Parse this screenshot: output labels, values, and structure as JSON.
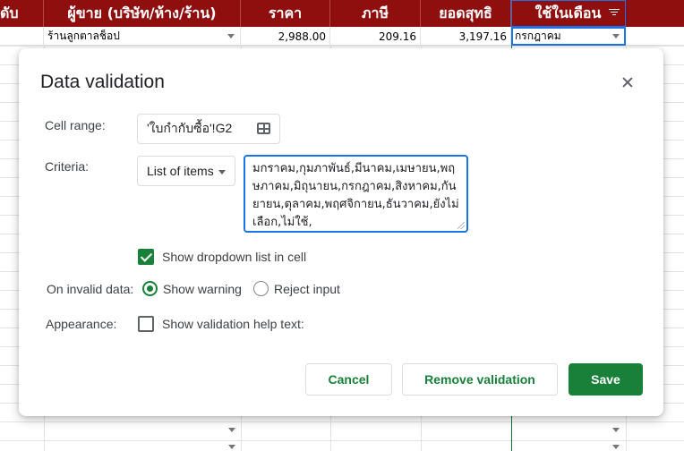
{
  "sheet": {
    "headers": [
      "ดับ",
      "ผู้ขาย (บริษัท/ห้าง/ร้าน)",
      "ราคา",
      "ภาษี",
      "ยอดสุทธิ",
      "ใช้ในเดือน"
    ],
    "row1": {
      "vendor": "ร้านลูกตาลช็อป",
      "price": "2,988.00",
      "tax": "209.16",
      "net": "3,197.16",
      "month": "กรกฎาคม"
    },
    "colors": {
      "header_bg": "#8f0f0f",
      "selection": "#1a73e8"
    }
  },
  "dialog": {
    "title": "Data validation",
    "cell_range_label": "Cell range:",
    "cell_range_value": "'ใบกำกับซื้อ'!G2",
    "criteria_label": "Criteria:",
    "criteria_type": "List of items",
    "criteria_items": "มกราคม,กุมภาพันธ์,มีนาคม,เมษายน,พฤษภาคม,มิถุนายน,กรกฎาคม,สิงหาคม,กันยายน,ตุลาคม,พฤศจิกายน,ธันวาคม,ยังไม่เลือก,ไม่ใช้,",
    "show_dropdown_label": "Show dropdown list in cell",
    "show_dropdown_checked": true,
    "invalid_label": "On invalid data:",
    "invalid_options": [
      "Show warning",
      "Reject input"
    ],
    "invalid_selected": "Show warning",
    "appearance_label": "Appearance:",
    "help_text_label": "Show validation help text:",
    "help_text_checked": false,
    "buttons": {
      "cancel": "Cancel",
      "remove": "Remove validation",
      "save": "Save"
    },
    "accent_color": "#188038"
  }
}
